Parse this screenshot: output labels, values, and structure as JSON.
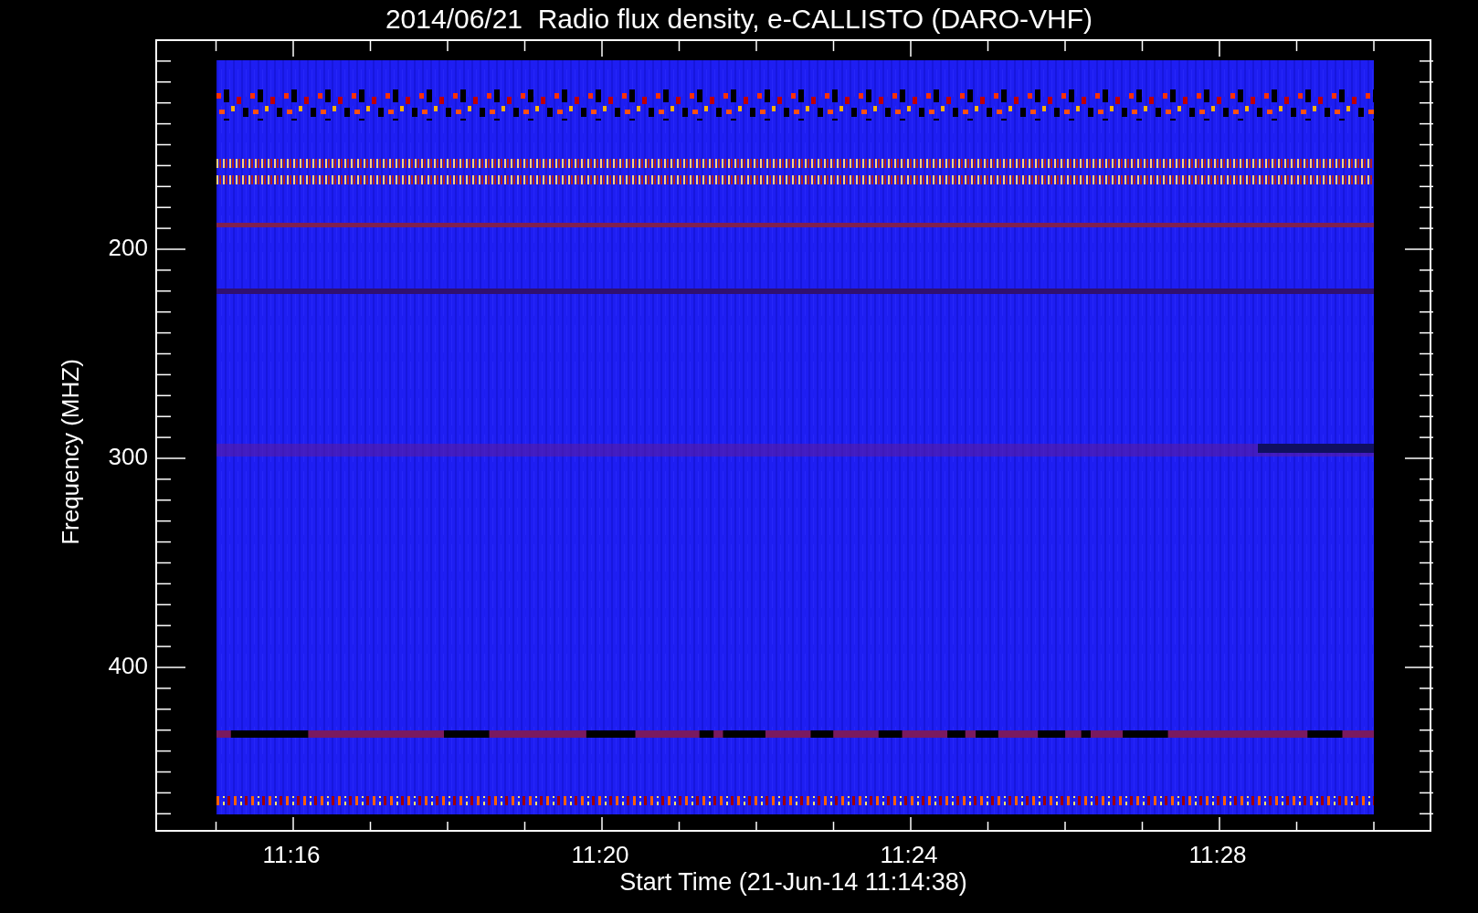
{
  "title": "2014/06/21  Radio flux density, e-CALLISTO (DARO-VHF)",
  "y_axis": {
    "label": "Frequency (MHZ)",
    "ticks": [
      "200",
      "300",
      "400"
    ]
  },
  "x_axis": {
    "label": "Start Time (21-Jun-14 11:14:38)",
    "ticks": [
      "11:16",
      "11:20",
      "11:24",
      "11:28"
    ]
  }
}
